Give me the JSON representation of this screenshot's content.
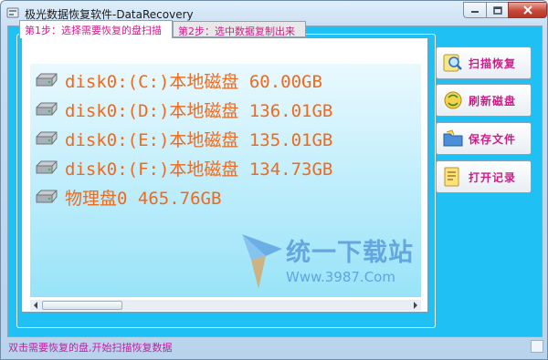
{
  "window": {
    "title": "极光数据恢复软件-DataRecovery"
  },
  "tabs": [
    {
      "label": "第1步：选择需要恢复的盘扫描",
      "active": true
    },
    {
      "label": "第2步：选中数据复制出来",
      "active": false
    }
  ],
  "disks": [
    {
      "label": "disk0:(C:)本地磁盘 60.00GB"
    },
    {
      "label": "disk0:(D:)本地磁盘 136.01GB"
    },
    {
      "label": "disk0:(E:)本地磁盘 135.01GB"
    },
    {
      "label": "disk0:(F:)本地磁盘 134.73GB"
    },
    {
      "label": "物理盘0 465.76GB"
    }
  ],
  "buttons": {
    "scan": "扫描恢复",
    "refresh": "刷新磁盘",
    "save": "保存文件",
    "log": "打开记录"
  },
  "watermark": {
    "name": "统一下载站",
    "url": "Www.3987.Com"
  },
  "status": {
    "text": "双击需要恢复的盘,开始扫描恢复数据"
  },
  "colors": {
    "accent_text": "#d11b8c",
    "disk_text": "#ee6a1d",
    "client_bg": "#1fc0f4"
  }
}
